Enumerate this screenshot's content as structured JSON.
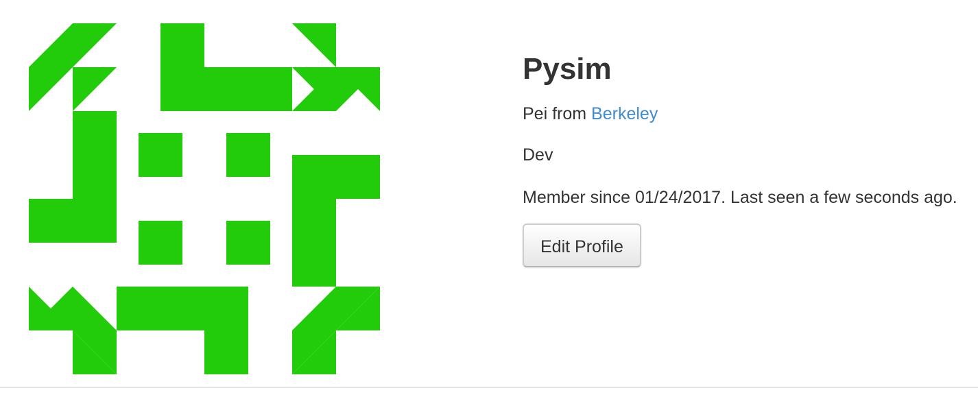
{
  "profile": {
    "username": "Pysim",
    "name": "Pei",
    "from_text": "from",
    "location": "Berkeley",
    "about": "Dev",
    "member_since": "Member since 01/24/2017. Last seen a few seconds ago.",
    "edit_button": "Edit Profile"
  },
  "avatar": {
    "icon": "identicon-icon",
    "color": "#22cc0b"
  },
  "colors": {
    "link": "#428bca",
    "text": "#333333"
  }
}
